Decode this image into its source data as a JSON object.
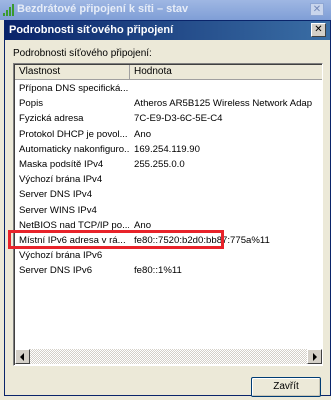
{
  "parent_window": {
    "title": "Bezdrátové připojení k síti – stav",
    "close_label": "✕"
  },
  "dialog": {
    "title": "Podrobnosti síťového připojení",
    "close_label": "✕",
    "section_label": "Podrobnosti síťového připojení:",
    "columns": {
      "property": "Vlastnost",
      "value": "Hodnota"
    },
    "rows": [
      {
        "property": "Přípona DNS specifická...",
        "value": ""
      },
      {
        "property": "Popis",
        "value": "Atheros AR5B125 Wireless Network Adap"
      },
      {
        "property": "Fyzická adresa",
        "value": "7C-E9-D3-6C-5E-C4"
      },
      {
        "property": "Protokol DHCP je povol...",
        "value": "Ano"
      },
      {
        "property": "Automaticky nakonfiguro...",
        "value": "169.254.119.90"
      },
      {
        "property": "Maska podsítě IPv4",
        "value": "255.255.0.0"
      },
      {
        "property": "Výchozí brána IPv4",
        "value": ""
      },
      {
        "property": "Server DNS IPv4",
        "value": ""
      },
      {
        "property": "Server WINS IPv4",
        "value": ""
      },
      {
        "property": "NetBIOS nad TCP/IP po...",
        "value": "Ano"
      },
      {
        "property": "Místní IPv6 adresa v rá...",
        "value": "fe80::7520:b2d0:bb87:775a%11"
      },
      {
        "property": "Výchozí brána IPv6",
        "value": ""
      },
      {
        "property": "Server DNS IPv6",
        "value": "fe80::1%11"
      }
    ],
    "close_button": "Zavřít"
  },
  "colors": {
    "highlight": "#e8232a",
    "title_active": "#0a246a"
  },
  "icons": [
    "signal-bars-icon",
    "close-icon",
    "scroll-left-arrow-icon",
    "scroll-right-arrow-icon"
  ]
}
